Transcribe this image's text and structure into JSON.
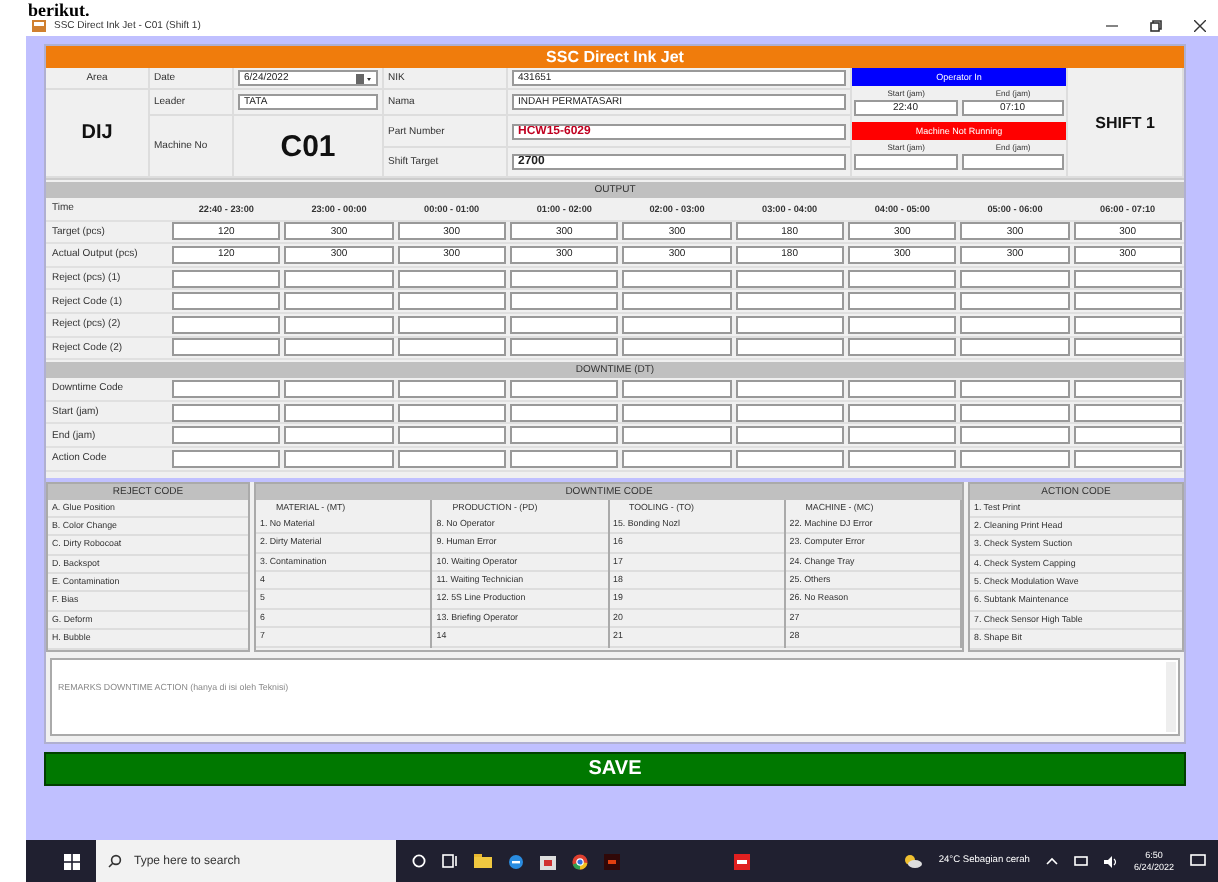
{
  "document_text": "berikut.",
  "window": {
    "title": "SSC Direct Ink Jet - C01 (Shift 1)"
  },
  "header": {
    "title": "SSC  Direct Ink Jet"
  },
  "info": {
    "area_label": "Area",
    "area_value": "DIJ",
    "date_label": "Date",
    "date_value": "6/24/2022",
    "leader_label": "Leader",
    "leader_value": "TATA",
    "machine_label": "Machine No",
    "machine_value": "C01",
    "nik_label": "NIK",
    "nik_value": "431651",
    "nama_label": "Nama",
    "nama_value": "INDAH PERMATASARI",
    "part_label": "Part Number",
    "part_value": "HCW15-6029",
    "target_label": "Shift Target",
    "target_value": "2700",
    "shift": "SHIFT 1"
  },
  "status": [
    {
      "label": "Operator In",
      "color": "#0000ff",
      "start_label": "Start (jam)",
      "start_value": "22:40",
      "end_label": "End (jam)",
      "end_value": "07:10"
    },
    {
      "label": "Machine Not Running",
      "color": "#ff0000",
      "start_label": "Start (jam)",
      "end_label": "End (jam)"
    }
  ],
  "output": {
    "title": "OUTPUT",
    "time_label": "Time",
    "times": [
      "22:40 - 23:00",
      "23:00 - 00:00",
      "00:00 - 01:00",
      "01:00 - 02:00",
      "02:00 - 03:00",
      "03:00 - 04:00",
      "04:00 - 05:00",
      "05:00 - 06:00",
      "06:00 - 07:10"
    ],
    "rows": [
      {
        "label": "Target (pcs)",
        "values": [
          "120",
          "300",
          "300",
          "300",
          "300",
          "180",
          "300",
          "300",
          "300"
        ]
      },
      {
        "label": "Actual Output (pcs)",
        "values": [
          "120",
          "300",
          "300",
          "300",
          "300",
          "180",
          "300",
          "300",
          "300"
        ]
      },
      {
        "label": "Reject (pcs) (1)"
      },
      {
        "label": "Reject Code (1)"
      },
      {
        "label": "Reject (pcs) (2)"
      },
      {
        "label": "Reject Code (2)"
      }
    ]
  },
  "downtime": {
    "title": "DOWNTIME (DT)",
    "rows": [
      "Downtime Code",
      "Start (jam)",
      "End (jam)",
      "Action Code"
    ]
  },
  "reject_code": {
    "title": "REJECT CODE",
    "items": [
      "A. Glue Position",
      "B. Color Change",
      "C. Dirty Robocoat",
      "D. Backspot",
      "E. Contamination",
      "F. Bias",
      "G. Deform",
      "H. Bubble"
    ]
  },
  "downtime_code": {
    "title": "DOWNTIME CODE",
    "columns": [
      {
        "title": "MATERIAL - (MT)",
        "items": [
          "1. No Material",
          "2. Dirty Material",
          "3. Contamination",
          "4",
          "5",
          "6",
          "7"
        ]
      },
      {
        "title": "PRODUCTION - (PD)",
        "items": [
          "8. No Operator",
          "9. Human Error",
          "10. Waiting Operator",
          "11. Waiting Technician",
          "12. 5S Line Production",
          "13. Briefing Operator",
          "14"
        ]
      },
      {
        "title": "TOOLING - (TO)",
        "items": [
          "15. Bonding Nozl",
          "16",
          "17",
          "18",
          "19",
          "20",
          "21"
        ]
      },
      {
        "title": "MACHINE - (MC)",
        "items": [
          "22. Machine DJ Error",
          "23. Computer Error",
          "24. Change Tray",
          "25. Others",
          "26. No Reason",
          "27",
          "28"
        ]
      }
    ]
  },
  "action_code": {
    "title": "ACTION CODE",
    "items": [
      "1. Test Print",
      "2. Cleaning Print Head",
      "3. Check System Suction",
      "4. Check System Capping",
      "5. Check Modulation Wave",
      "6. Subtank Maintenance",
      "7. Check Sensor High Table",
      "8. Shape Bit"
    ]
  },
  "remarks": {
    "placeholder": "REMARKS DOWNTIME ACTION (hanya di isi oleh Teknisi)"
  },
  "save_button": "SAVE",
  "taskbar": {
    "search_placeholder": "Type here to search",
    "weather": "24°C  Sebagian cerah",
    "time": "6:50",
    "date": "6/24/2022"
  }
}
